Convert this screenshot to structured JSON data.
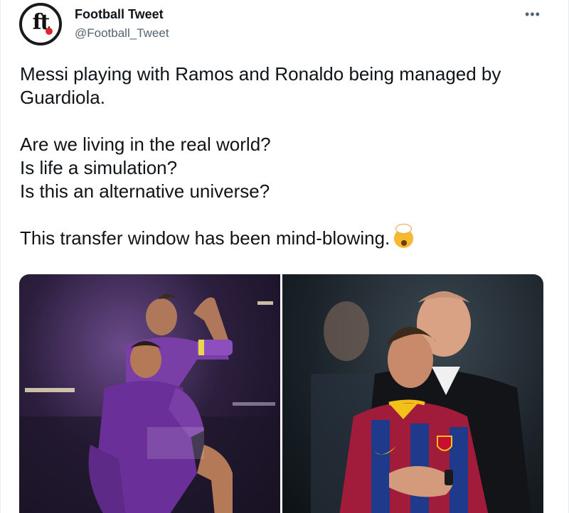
{
  "author": {
    "display_name": "Football Tweet",
    "handle": "@Football_Tweet",
    "avatar_text": "ft",
    "avatar_icon": "ft-logo"
  },
  "more_icon": "•••",
  "tweet": {
    "line1": "Messi playing with Ramos and Ronaldo being managed by Guardiola.",
    "line2": "Are we living in the real world?",
    "line3": "Is life a simulation?",
    "line4": "Is this an alternative universe?",
    "line5": "This transfer window has been mind-blowing.",
    "emoji": "exploding-head-emoji"
  },
  "media": {
    "photos": [
      {
        "name": "ramos-ronaldo-celebration-photo"
      },
      {
        "name": "guardiola-messi-hug-photo"
      }
    ]
  },
  "colors": {
    "text": "#0f1419",
    "secondary": "#536471",
    "emoji": "#f5b82e",
    "avatar_accent": "#e0242a"
  }
}
